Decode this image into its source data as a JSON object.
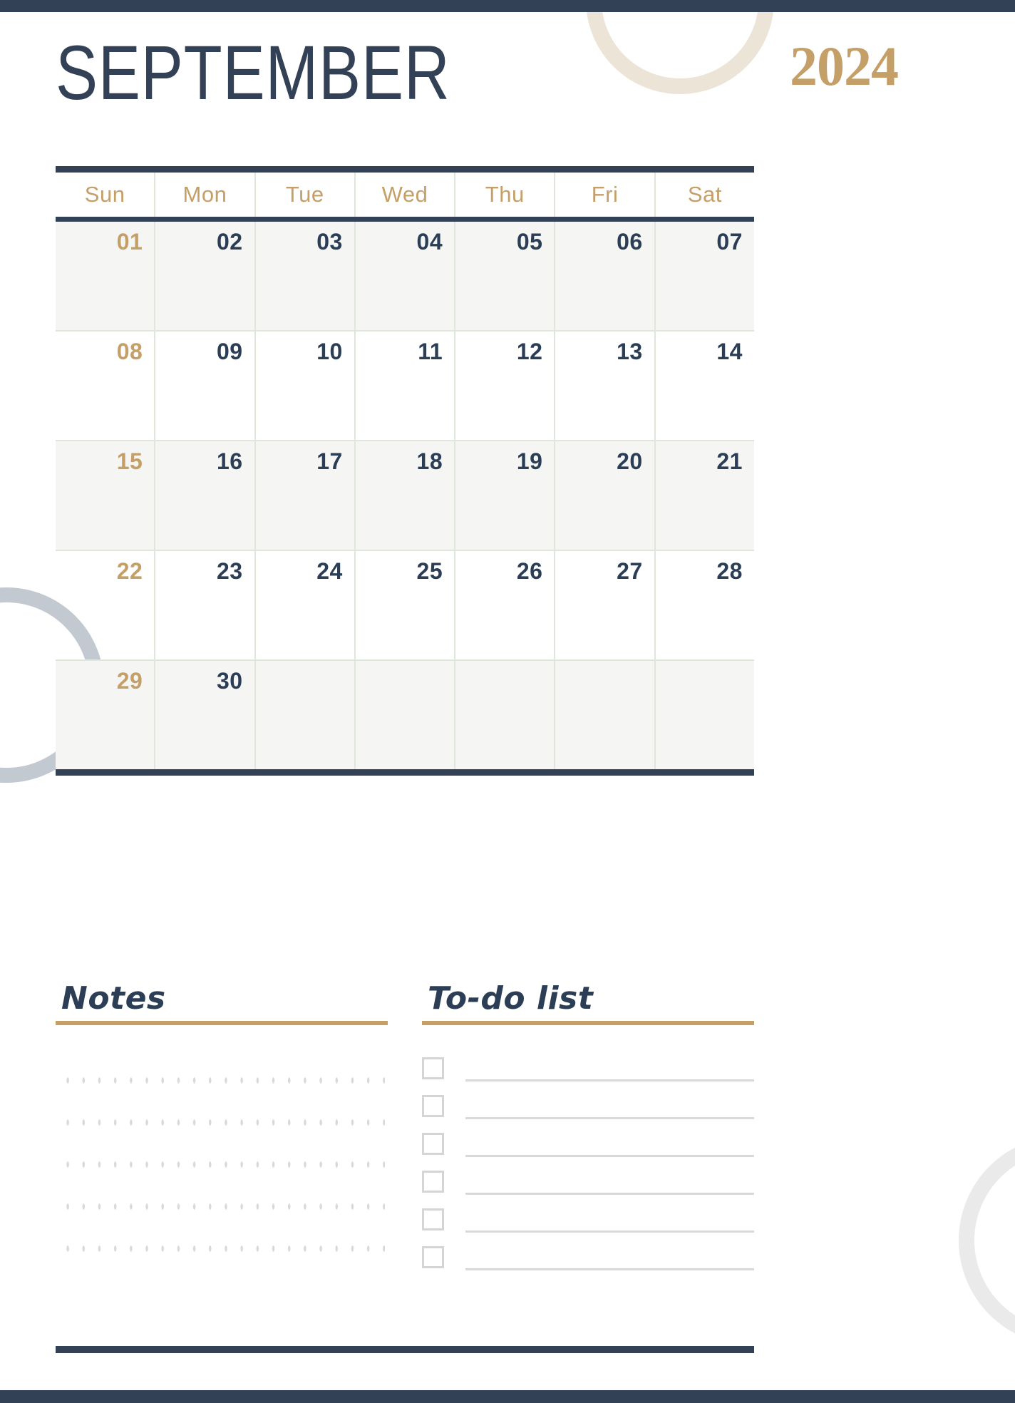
{
  "document": {
    "type": "monthly-calendar-planner",
    "month": "SEPTEMBER",
    "year": "2024"
  },
  "colors": {
    "navy": "#334156",
    "gold": "#c49f67",
    "grid_line": "#dfe7dc",
    "row_shade": "#f5f6f4",
    "cream_ring": "#ece5d7",
    "grayblue_ring": "#c3c9d1",
    "lightgray_ring": "#eaeaea"
  },
  "calendar": {
    "weekdays": [
      "Sun",
      "Mon",
      "Tue",
      "Wed",
      "Thu",
      "Fri",
      "Sat"
    ],
    "weeks": [
      {
        "shaded": true,
        "days": [
          "01",
          "02",
          "03",
          "04",
          "05",
          "06",
          "07"
        ]
      },
      {
        "shaded": false,
        "days": [
          "08",
          "09",
          "10",
          "11",
          "12",
          "13",
          "14"
        ]
      },
      {
        "shaded": true,
        "days": [
          "15",
          "16",
          "17",
          "18",
          "19",
          "20",
          "21"
        ]
      },
      {
        "shaded": false,
        "days": [
          "22",
          "23",
          "24",
          "25",
          "26",
          "27",
          "28"
        ]
      },
      {
        "shaded": true,
        "days": [
          "29",
          "30",
          "",
          "",
          "",
          "",
          ""
        ]
      }
    ]
  },
  "notes": {
    "title": "Notes",
    "content": ""
  },
  "todo": {
    "title": "To-do list",
    "items": [
      "",
      "",
      "",
      "",
      "",
      ""
    ]
  }
}
